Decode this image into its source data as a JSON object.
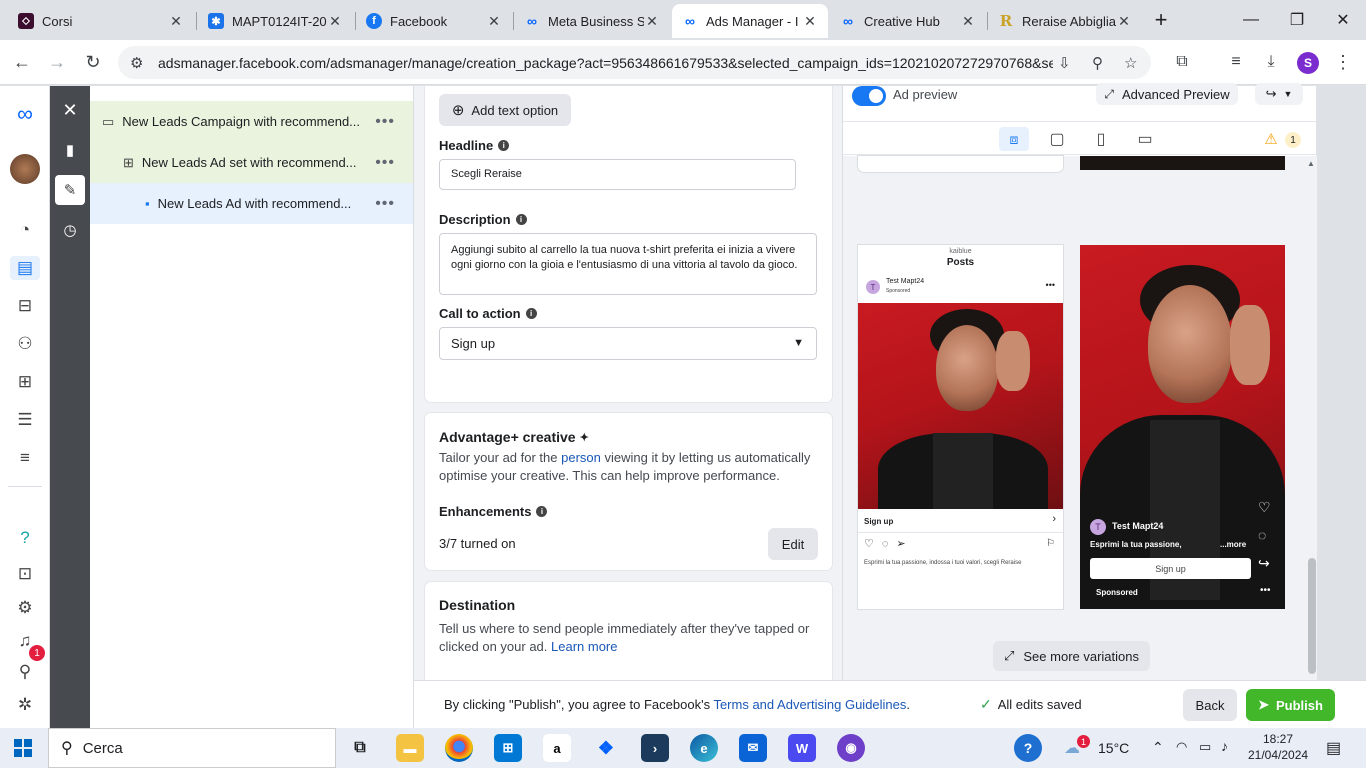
{
  "browser": {
    "tabs": [
      {
        "title": "Corsi",
        "favicon": "corsi-icon",
        "color": "#3b0d2e",
        "active": false
      },
      {
        "title": "MAPT0124IT-20",
        "favicon": "mapt-icon",
        "color": "#1a73e8",
        "active": false
      },
      {
        "title": "Facebook",
        "favicon": "facebook-icon",
        "color": "#1877f2",
        "active": false
      },
      {
        "title": "Meta Business S",
        "favicon": "meta-icon",
        "color": "#0866ff",
        "active": false
      },
      {
        "title": "Ads Manager - I",
        "favicon": "meta-icon",
        "color": "#0866ff",
        "active": true
      },
      {
        "title": "Creative Hub",
        "favicon": "meta-icon",
        "color": "#0866ff",
        "active": false
      },
      {
        "title": "Reraise Abbiglia",
        "favicon": "reraise-icon",
        "color": "#c9a227",
        "active": false
      }
    ],
    "new_tab": "+",
    "url": "adsmanager.facebook.com/adsmanager/manage/creation_package?act=956348661679533&selected_campaign_ids=120210207272970768&se...",
    "profile_initial": "S"
  },
  "tree": {
    "campaign": "New Leads Campaign with recommend...",
    "adset": "New Leads Ad set with recommend...",
    "ad": "New Leads Ad with recommend..."
  },
  "editor": {
    "add_text_option": "Add text option",
    "headline_label": "Headline",
    "headline_value": "Scegli Reraise",
    "description_label": "Description",
    "description_value": "Aggiungi subito al carrello la tua nuova t-shirt preferita ei inizia a vivere ogni giorno con la gioia e l'entusiasmo di una vittoria al tavolo da gioco.",
    "cta_label": "Call to action",
    "cta_value": "Sign up",
    "advantage_title": "Advantage+ creative",
    "advantage_text_1": "Tailor your ad for the ",
    "advantage_link": "person",
    "advantage_text_2": " viewing it by letting us automatically optimise your creative. This can help improve performance.",
    "enhancements_label": "Enhancements",
    "enhancements_value": "3/7 turned on",
    "edit_button": "Edit",
    "destination_title": "Destination",
    "destination_text": "Tell us where to send people immediately after they've tapped or clicked on your ad. ",
    "destination_link": "Learn more"
  },
  "preview": {
    "ad_preview_label": "Ad preview",
    "advanced_preview": "Advanced Preview",
    "warning_count": "1",
    "feed": {
      "username_top": "kaiblue",
      "posts_title": "Posts",
      "account": "Test Mapt24",
      "sponsored": "Sponsored",
      "cta": "Sign up",
      "caption": "Esprimi la tua passione, indossa i tuoi valori, scegli Reraise"
    },
    "reels": {
      "account": "Test Mapt24",
      "caption": "Esprimi la tua passione,",
      "more": "...more",
      "cta": "Sign up",
      "sponsored": "Sponsored"
    },
    "see_more": "See more variations"
  },
  "footer": {
    "agree_text": "By clicking \"Publish\", you agree to Facebook's ",
    "terms_link": "Terms and Advertising Guidelines",
    "period": ".",
    "saved_status": "All edits saved",
    "back": "Back",
    "publish": "Publish"
  },
  "rail": {
    "notification_badge": "1"
  },
  "taskbar": {
    "search_placeholder": "Cerca",
    "weather": "15°C",
    "weather_badge": "1",
    "time": "18:27",
    "date": "21/04/2024"
  },
  "colors": {
    "fb_blue": "#1877f2",
    "publish_green": "#42b72a",
    "selected_row": "#e7f0fd",
    "highlight_row": "#eaf3de",
    "saved_green": "#31a24c"
  }
}
